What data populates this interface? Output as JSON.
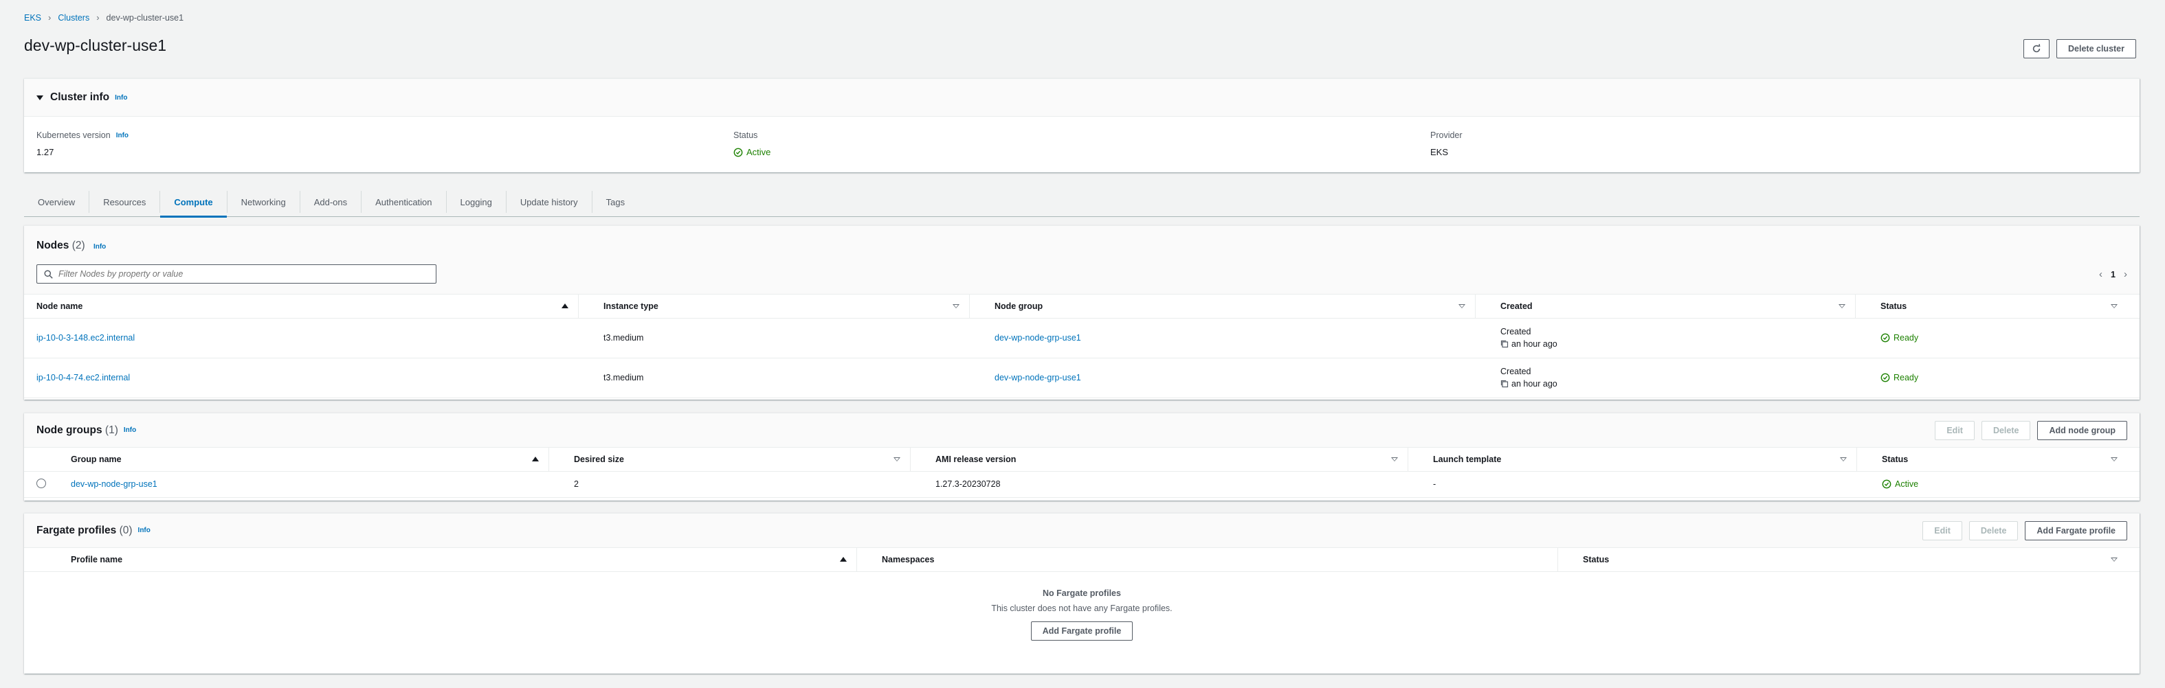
{
  "breadcrumb": {
    "root": "EKS",
    "parent": "Clusters",
    "current": "dev-wp-cluster-use1"
  },
  "page": {
    "title": "dev-wp-cluster-use1",
    "delete_label": "Delete cluster"
  },
  "cluster_info": {
    "title": "Cluster info",
    "info": "Info",
    "k8s_label": "Kubernetes version",
    "k8s_value": "1.27",
    "status_label": "Status",
    "status_value": "Active",
    "provider_label": "Provider",
    "provider_value": "EKS"
  },
  "tabs": [
    "Overview",
    "Resources",
    "Compute",
    "Networking",
    "Add-ons",
    "Authentication",
    "Logging",
    "Update history",
    "Tags"
  ],
  "nodes": {
    "title": "Nodes",
    "count": "(2)",
    "info": "Info",
    "filter_placeholder": "Filter Nodes by property or value",
    "page": "1",
    "columns": [
      "Node name",
      "Instance type",
      "Node group",
      "Created",
      "Status"
    ],
    "rows": [
      {
        "name": "ip-10-0-3-148.ec2.internal",
        "type": "t3.medium",
        "group": "dev-wp-node-grp-use1",
        "created_label": "Created",
        "created_value": "an hour ago",
        "status": "Ready"
      },
      {
        "name": "ip-10-0-4-74.ec2.internal",
        "type": "t3.medium",
        "group": "dev-wp-node-grp-use1",
        "created_label": "Created",
        "created_value": "an hour ago",
        "status": "Ready"
      }
    ]
  },
  "node_groups": {
    "title": "Node groups",
    "count": "(1)",
    "info": "Info",
    "edit": "Edit",
    "delete": "Delete",
    "add": "Add node group",
    "columns": [
      "Group name",
      "Desired size",
      "AMI release version",
      "Launch template",
      "Status"
    ],
    "rows": [
      {
        "name": "dev-wp-node-grp-use1",
        "size": "2",
        "ami": "1.27.3-20230728",
        "template": "-",
        "status": "Active"
      }
    ]
  },
  "fargate": {
    "title": "Fargate profiles",
    "count": "(0)",
    "info": "Info",
    "edit": "Edit",
    "delete": "Delete",
    "add": "Add Fargate profile",
    "columns": [
      "Profile name",
      "Namespaces",
      "Status"
    ],
    "empty_title": "No Fargate profiles",
    "empty_sub": "This cluster does not have any Fargate profiles.",
    "empty_button": "Add Fargate profile"
  },
  "colors": {
    "link": "#0073bb",
    "success": "#1d8102",
    "background": "#f2f3f3"
  },
  "icons": [
    "chevron-right-icon",
    "refresh-icon",
    "caret-down-icon",
    "check-circle-icon",
    "search-icon",
    "copy-icon",
    "sort-asc-icon",
    "sort-desc-icon"
  ]
}
